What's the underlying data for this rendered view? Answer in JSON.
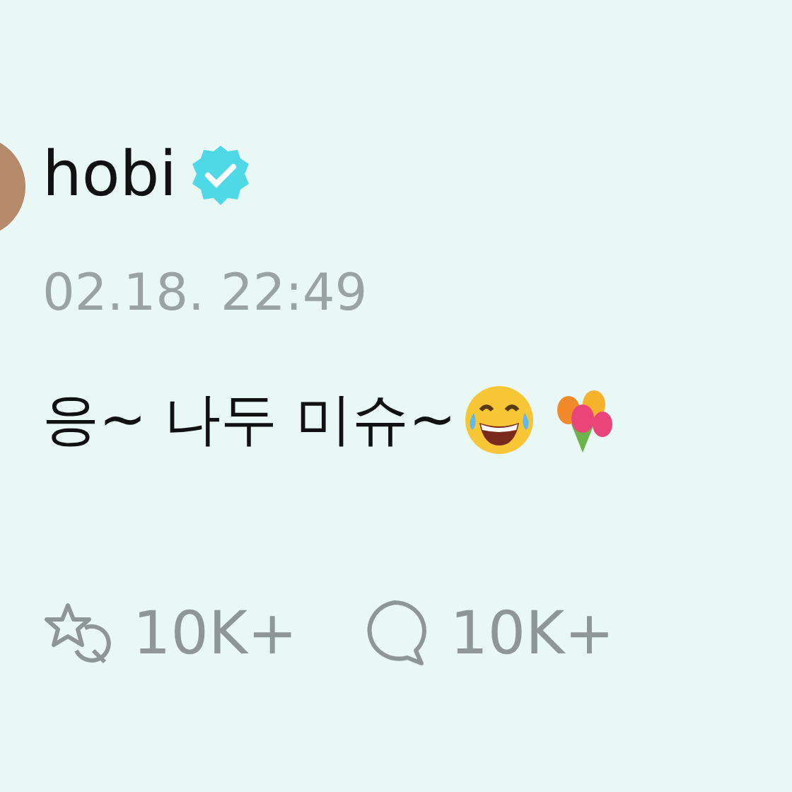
{
  "post": {
    "author": "hobi",
    "verified": true,
    "time": "02.18. 22:49",
    "text": "응~ 나두 미슈~",
    "reactions": [
      {
        "kind": "like",
        "count": "10K+"
      },
      {
        "kind": "comment",
        "count": "10K+"
      }
    ]
  }
}
